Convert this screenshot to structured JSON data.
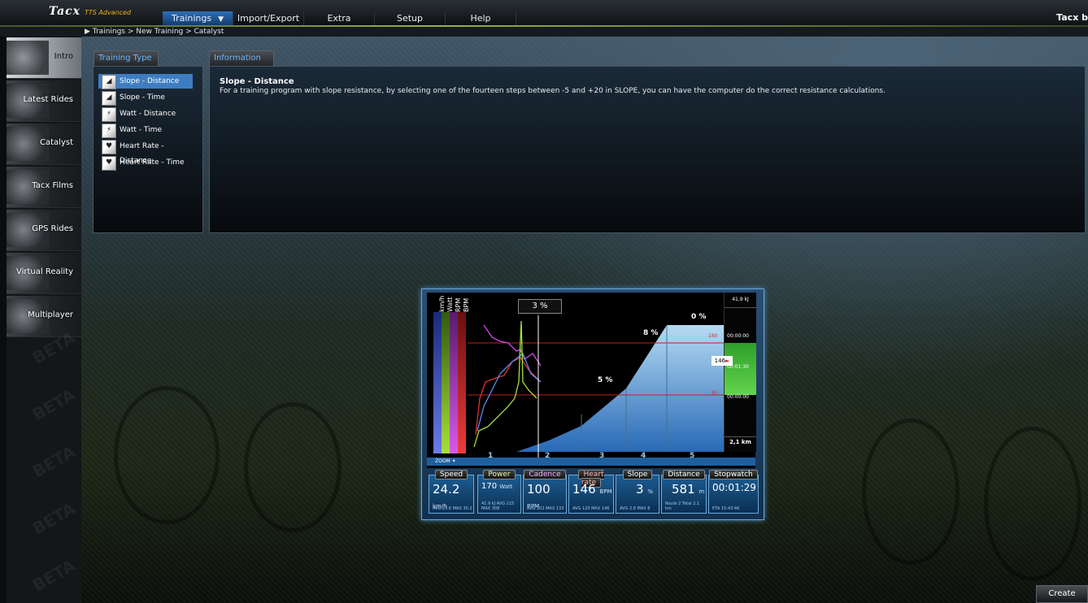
{
  "app": {
    "brand": "Tacx",
    "edition": "TTS Advanced",
    "right_label": "Tacx b"
  },
  "menu": [
    {
      "label": "Trainings",
      "active": true
    },
    {
      "label": "Import/Export"
    },
    {
      "label": "Extra"
    },
    {
      "label": "Setup"
    },
    {
      "label": "Help"
    }
  ],
  "breadcrumb": "Trainings > New Training > Catalyst",
  "sidebar": {
    "items": [
      "Intro",
      "Latest Rides",
      "Catalyst",
      "Tacx Films",
      "GPS Rides",
      "Virtual Reality",
      "Multiplayer"
    ]
  },
  "watermark": "BETA",
  "training_type": {
    "tab": "Training Type",
    "items": [
      "Slope - Distance",
      "Slope - Time",
      "Watt - Distance",
      "Watt - Time",
      "Heart Rate - Distance",
      "Heart Rate - Time"
    ],
    "selected": 0
  },
  "information": {
    "tab": "Information",
    "title": "Slope - Distance",
    "text": "For a training program with slope resistance, by selecting one of the fourteen steps between -5 and +20 in SLOPE, you can have the computer do the correct resistance calculations."
  },
  "chart": {
    "vertical_labels": [
      "km/h",
      "Watt",
      "RPM",
      "BPM"
    ],
    "slope_callout": "3 %",
    "slope_labels": [
      "5 %",
      "8 %",
      "0 %"
    ],
    "x_ticks": [
      "1",
      "2",
      "3",
      "4",
      "5"
    ],
    "distance_total": "2,1 km",
    "energy": "41,9 kJ",
    "zone_high": "180",
    "zone_low": "80",
    "hr_marker": "146",
    "times": [
      "00:00:00",
      "00:01:30",
      "00:00:00"
    ],
    "zoom_label": "ZOOM"
  },
  "stats": [
    {
      "head": "Speed",
      "value": "24.2",
      "unit": "km/h",
      "sub": "AVG 23.6  MAX 30.2"
    },
    {
      "head": "Power",
      "value": "170",
      "unit": "Watt",
      "sub": "41.9 kJ  AVG 115  MAX 308"
    },
    {
      "head": "Cadence",
      "value": "100",
      "unit": "RPM",
      "sub": "AVG 102  MAX 133"
    },
    {
      "head": "Heart rate",
      "value": "146",
      "unit": "BPM",
      "sub": "AVG 120  MAX 146"
    },
    {
      "head": "Slope",
      "value": "3",
      "unit": "%",
      "sub": "AVG 2.8  MAX 8"
    },
    {
      "head": "Distance",
      "value": "581",
      "unit": "m",
      "sub": "Route 2  Total 2.1 km"
    },
    {
      "head": "Stopwatch",
      "value": "00:01:29",
      "unit": "",
      "sub": "ETA 15:43:46"
    }
  ],
  "create_button": "Create"
}
